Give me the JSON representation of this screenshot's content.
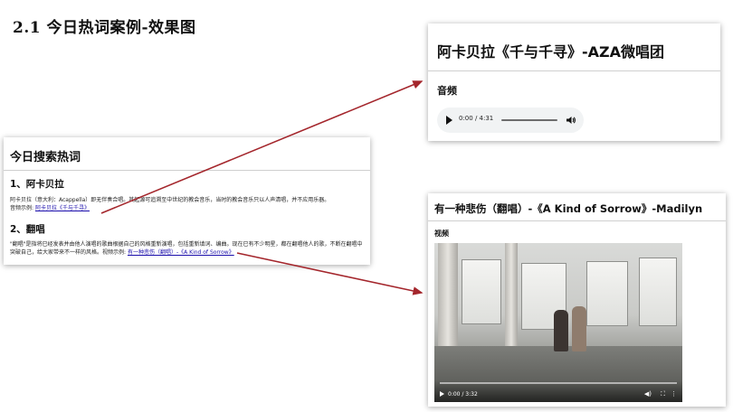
{
  "slide": {
    "title": "2.1  今日热词案例-效果图"
  },
  "search_card": {
    "title": "今日搜索热词",
    "items": [
      {
        "heading": "1、阿卡贝拉",
        "text": "阿卡贝拉（意大利：Acappella）即无伴奏合唱。其起源可追溯至中世纪的教会音乐，当时的教会音乐只以人声清唱，并不应用乐器。",
        "example_prefix": "音频示例:",
        "example_link": "阿卡贝拉《千与千寻》"
      },
      {
        "heading": "2、翻唱",
        "text": "\"翻唱\"是指将已经发表并由他人演唱的歌曲根据自己的风格重新演唱，包括重新填词、编曲。现在已有不少明星，都在翻唱他人的歌，不断在翻唱中突破自己，给大家带来不一样的风格。视频示例:",
        "example_link": "有一种悲伤（翻唱）-《A Kind of Sorrow》"
      }
    ]
  },
  "audio_card": {
    "title": "阿卡贝拉《千与千寻》-AZA微唱团",
    "section_label": "音频",
    "player": {
      "time": "0:00 / 4:31",
      "progress": 0
    }
  },
  "video_card": {
    "title": "有一种悲伤（翻唱）-《A Kind of Sorrow》-Madilyn",
    "section_label": "视频",
    "player": {
      "time": "0:00 / 3:32",
      "progress": 0
    }
  },
  "colors": {
    "arrow": "#a4262c",
    "link": "#1a0dab",
    "audio_player_bg": "#f1f3f4"
  },
  "icons": [
    "play-icon",
    "volume-icon",
    "fullscreen-icon",
    "more-icon"
  ]
}
